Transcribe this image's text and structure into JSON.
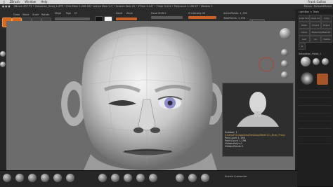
{
  "menubar": {
    "items": [
      "ZBrush",
      "Window",
      "Help"
    ],
    "right": "Frank Gullios"
  },
  "titlebar": {
    "text": "ZBrush 4R7 P3 • Sebastian_Head_1.ZPR • Free Mem 1.298 GB • Active Mem 2.5 • Scratch Disk 49 • ZTime 3.147 • Timer 0.014 • Polycount 1.196 KP • Meshes 1",
    "right_label": "Menus",
    "right_label2": "DefaultZScript"
  },
  "toolbar": {
    "draw_label": "Draw",
    "move_label": "Move",
    "scale_label": "Scale",
    "rotate_label": "Rotate",
    "mrgb": "Mrgb",
    "rgb": "Rgb",
    "m": "M",
    "zadd": "Zadd",
    "zsub": "Zsub",
    "zcut": "Zcut",
    "focal_shift_label": "Focal Shift 0",
    "draw_size_label": "Draw Size 64",
    "z_intensity_label": "Z Intensity 25",
    "rgb_intensity_label": "Rgb Intensity 100",
    "active_points": "ActivePoints: 1,196",
    "total_points": "TotalPoints: 1,196",
    "dynamic": "Dynamic"
  },
  "thumbnail": {
    "title": "Subtool: 1",
    "path": "/Users/Frankgullios/Desktop/Week1/1_Bust_Proxy",
    "stats": [
      "PolyCount 1.196",
      "PointCount 1.196",
      "HiddenPolys 0",
      "HiddenPoints 0"
    ]
  },
  "right_panel": {
    "buttons": [
      "Load Tool",
      "Save As",
      "Copy Tool",
      "Paste Tool",
      "Import",
      "Export",
      "Clone",
      "Make PolyMesh3D",
      "GoZ",
      "All",
      "Visible",
      "R"
    ],
    "lightbox": "LightBox > Tools",
    "tool_label": "Sebastian_Head_1"
  },
  "bottombar": {
    "brushes": [
      "Standard",
      "Move",
      "ClayBuildup",
      "DamStandard",
      "Inflat",
      "Pinch",
      "TrimDynamic",
      "hPolish",
      "Dam_Standard",
      "Move Topo",
      "Smooth",
      "Clay"
    ],
    "enable_label": "Enable Customize"
  },
  "colors": {
    "accent": "#d66a1e",
    "viewport": "#6a6a6a",
    "panel": "#1f1f1f"
  }
}
